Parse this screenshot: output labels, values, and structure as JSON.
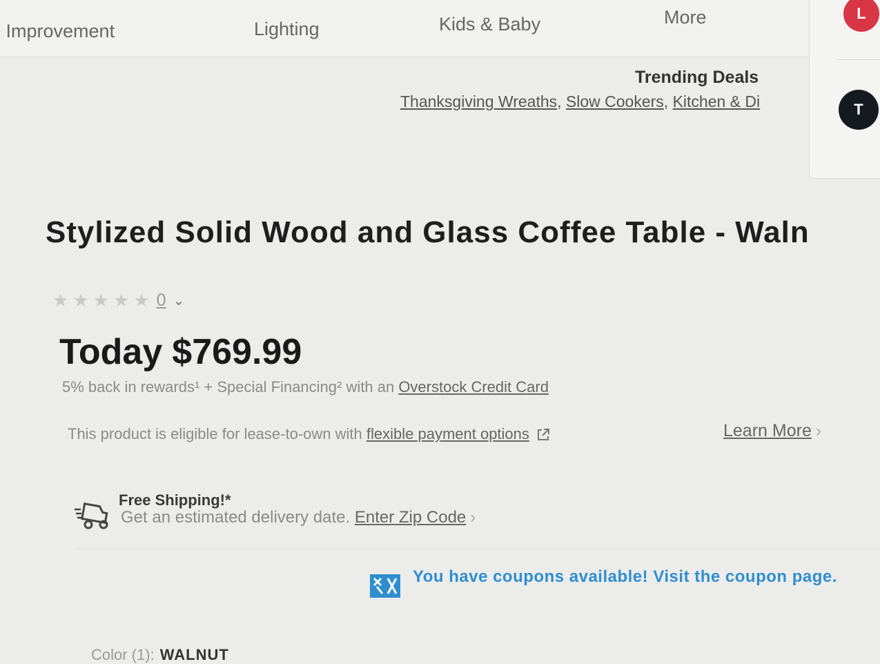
{
  "nav": {
    "items": [
      "e Improvement",
      "Lighting",
      "Kids & Baby",
      "More"
    ]
  },
  "side": {
    "avatar_top": "L",
    "avatar_bottom": "T"
  },
  "trending": {
    "title": "Trending Deals",
    "links": [
      "Thanksgiving Wreaths",
      "Slow Cookers",
      "Kitchen & Di"
    ]
  },
  "product": {
    "title": "Stylized Solid Wood and Glass Coffee Table - Waln",
    "rating_count": "0",
    "rating_stars": 0,
    "price_label": "Today",
    "price": "$769.99"
  },
  "rewards": {
    "text": "5% back in rewards¹ + Special Financing² with an",
    "link": "Overstock Credit Card"
  },
  "lease": {
    "text": "This product is eligible for lease-to-own with",
    "link": "flexible payment options",
    "learn_more": "Learn More"
  },
  "shipping": {
    "title": "Free Shipping!*",
    "text": "Get an estimated delivery date.",
    "link": "Enter Zip Code"
  },
  "coupon": {
    "text": "You have coupons available! Visit the coupon page."
  },
  "color": {
    "label": "Color (1):",
    "value": "WALNUT"
  },
  "colors": {
    "accent_blue": "#2f8ecf",
    "avatar_red": "#d83545",
    "avatar_dark": "#151a20"
  }
}
